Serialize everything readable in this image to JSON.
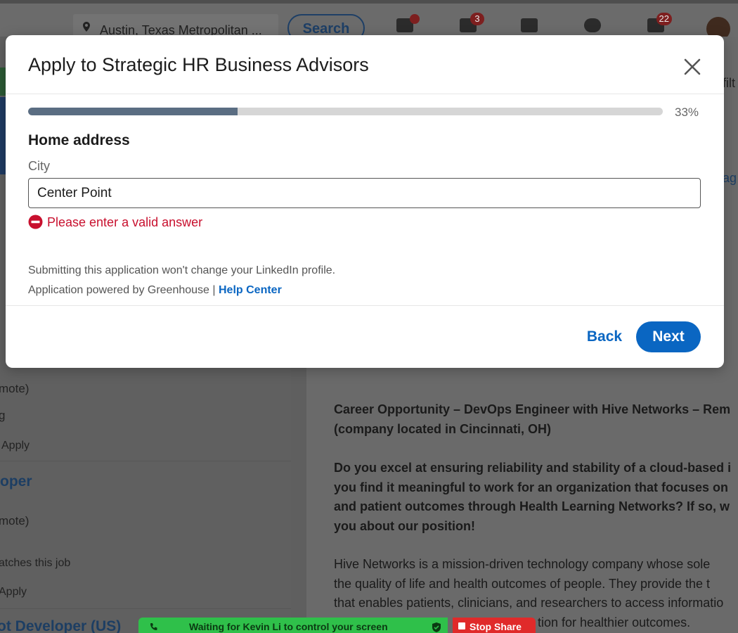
{
  "background": {
    "location_text": "Austin, Texas Metropolitan ...",
    "search_label": "Search",
    "nav_badges": {
      "home": "",
      "network": "3",
      "notifications": "22"
    },
    "left_fragments": [
      {
        "text": "mote)",
        "kind": "text"
      },
      {
        "text": "g",
        "kind": "text"
      },
      {
        "text": "Apply",
        "kind": "text"
      },
      {
        "text": "oper",
        "kind": "link"
      },
      {
        "text": "mote)",
        "kind": "text"
      },
      {
        "text": "atches this job",
        "kind": "text"
      },
      {
        "text": "Apply",
        "kind": "text"
      },
      {
        "text": "ot Developer (US)",
        "kind": "link"
      }
    ],
    "right_fragments": [
      "ag",
      "filt"
    ],
    "article": {
      "heading_lines": [
        "Career Opportunity – DevOps Engineer with Hive Networks – Rem",
        "(company located in Cincinnati, OH)"
      ],
      "question_lines": [
        "Do you excel at ensuring reliability and stability of a cloud-based i",
        "you find it meaningful to work for an organization that focuses on",
        "and patient outcomes through Health Learning Networks? If so, w",
        "you about our position!"
      ],
      "body_lines": [
        "Hive Networks is a mission-driven technology company whose sole",
        "the quality of life and health outcomes of people. They provide the t",
        "that enables patients, clinicians, and researchers to access informatio",
        "tion for healthier outcomes."
      ]
    },
    "screen_share": {
      "status": "Waiting for Kevin Li to control your screen",
      "stop_label": "Stop Share"
    }
  },
  "modal": {
    "title": "Apply to Strategic HR Business Advisors",
    "progress": {
      "value": 0.33,
      "label": "33%"
    },
    "section_title": "Home address",
    "field": {
      "label": "City",
      "value": "Center Point",
      "error": "Please enter a valid answer"
    },
    "footnote": "Submitting this application won't change your LinkedIn profile.",
    "powered_by": "Application powered by Greenhouse |",
    "help_link": "Help Center",
    "back_label": "Back",
    "next_label": "Next"
  },
  "colors": {
    "accent": "#0a66c2",
    "error": "#c8102e",
    "progress_fill": "#5a6d82",
    "progress_track": "#d6d6d6",
    "share_green": "#2fc04a",
    "share_red": "#e02a2a"
  }
}
